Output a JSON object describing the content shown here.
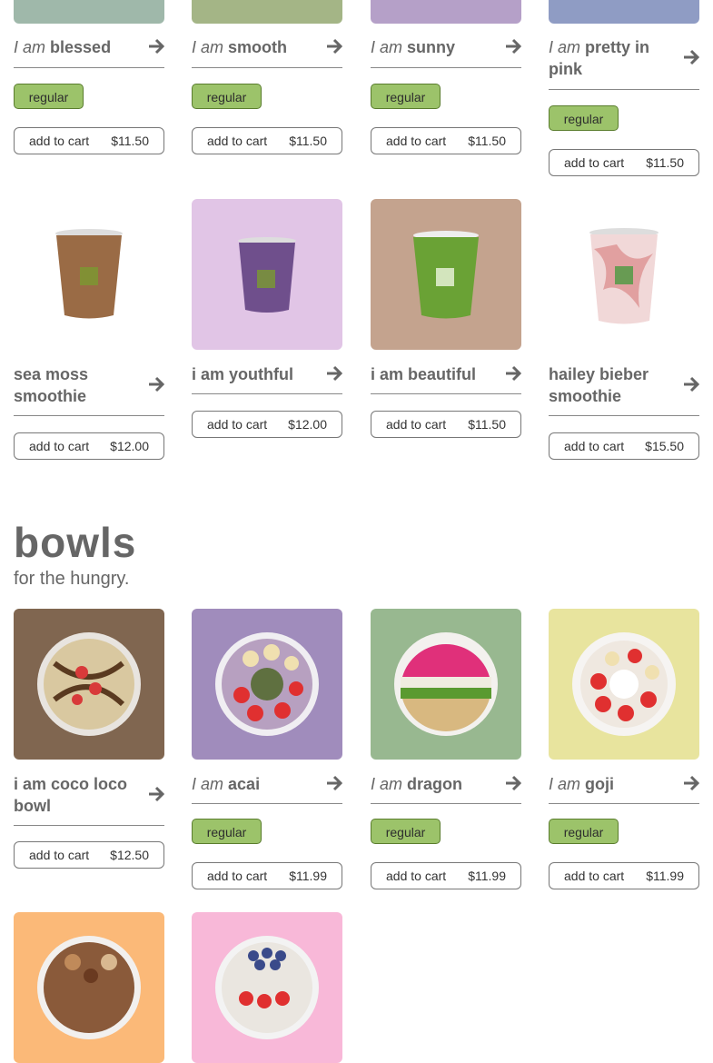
{
  "smoothies_row1": [
    {
      "prefix": "I am",
      "name": "blessed",
      "size": "regular",
      "cart": "add to cart",
      "price": "$11.50",
      "bg": "#9fb8aa"
    },
    {
      "prefix": "I am",
      "name": "smooth",
      "size": "regular",
      "cart": "add to cart",
      "price": "$11.50",
      "bg": "#a4b586"
    },
    {
      "prefix": "I am",
      "name": "sunny",
      "size": "regular",
      "cart": "add to cart",
      "price": "$11.50",
      "bg": "#b5a0c8"
    },
    {
      "prefix": "I am",
      "name": "pretty in pink",
      "size": "regular",
      "cart": "add to cart",
      "price": "$11.50",
      "bg": "#8f9cc4"
    }
  ],
  "smoothies_row2": [
    {
      "name": "sea moss smoothie",
      "cart": "add to cart",
      "price": "$12.00",
      "bg": "#ffffff",
      "cup": "#9a6b45"
    },
    {
      "name": "i am youthful",
      "cart": "add to cart",
      "price": "$12.00",
      "bg": "#e1c5e6",
      "cup": "#6f4f8c"
    },
    {
      "name": "i am beautiful",
      "cart": "add to cart",
      "price": "$11.50",
      "bg": "#c4a38e",
      "cup": "#6aa235"
    },
    {
      "name": "hailey bieber smoothie",
      "cart": "add to cart",
      "price": "$15.50",
      "bg": "#ffffff",
      "cup": "#e1a0a0"
    }
  ],
  "bowls": {
    "title": "bowls",
    "subtitle": "for the hungry.",
    "row1": [
      {
        "name": "i am coco loco bowl",
        "cart": "add to cart",
        "price": "$12.50",
        "bg": "#806650"
      },
      {
        "prefix": "I am",
        "name": "acai",
        "size": "regular",
        "cart": "add to cart",
        "price": "$11.99",
        "bg": "#a08cbc"
      },
      {
        "prefix": "I am",
        "name": "dragon",
        "size": "regular",
        "cart": "add to cart",
        "price": "$11.99",
        "bg": "#98b890"
      },
      {
        "prefix": "I am",
        "name": "goji",
        "size": "regular",
        "cart": "add to cart",
        "price": "$11.99",
        "bg": "#e8e49e"
      }
    ],
    "row2": [
      {
        "bg": "#fbb978"
      },
      {
        "bg": "#f8b8d8"
      }
    ]
  },
  "colors": {
    "pill": "#9cc36a",
    "text": "#666666"
  }
}
